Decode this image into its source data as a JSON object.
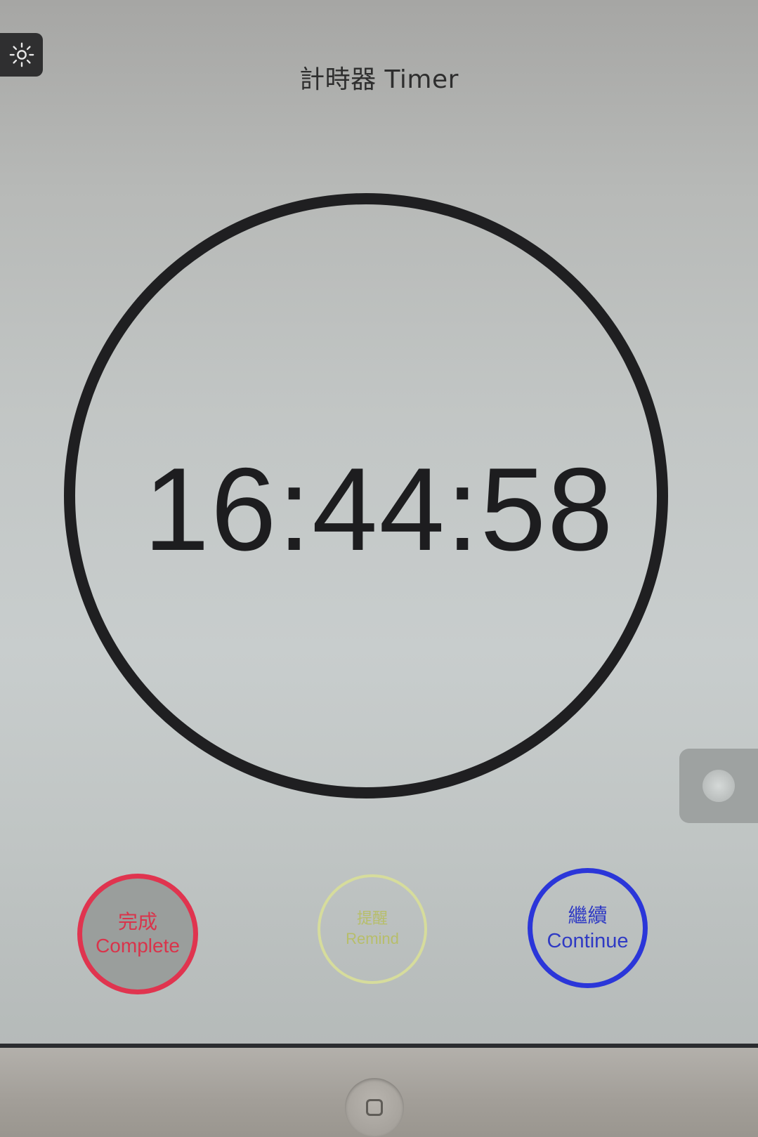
{
  "header": {
    "title": "計時器 Timer",
    "brightness_icon": "sun-icon"
  },
  "timer": {
    "display": "16:44:58"
  },
  "actions": {
    "complete": {
      "zh": "完成",
      "en": "Complete",
      "color": "#e0344f"
    },
    "remind": {
      "zh": "提醒",
      "en": "Remind",
      "color": "#d6dc9c"
    },
    "continue": {
      "zh": "繼續",
      "en": "Continue",
      "color": "#2b36d9"
    }
  },
  "device": {
    "lock_icon": "assistive-touch-icon",
    "home_icon": "home-button-icon"
  }
}
